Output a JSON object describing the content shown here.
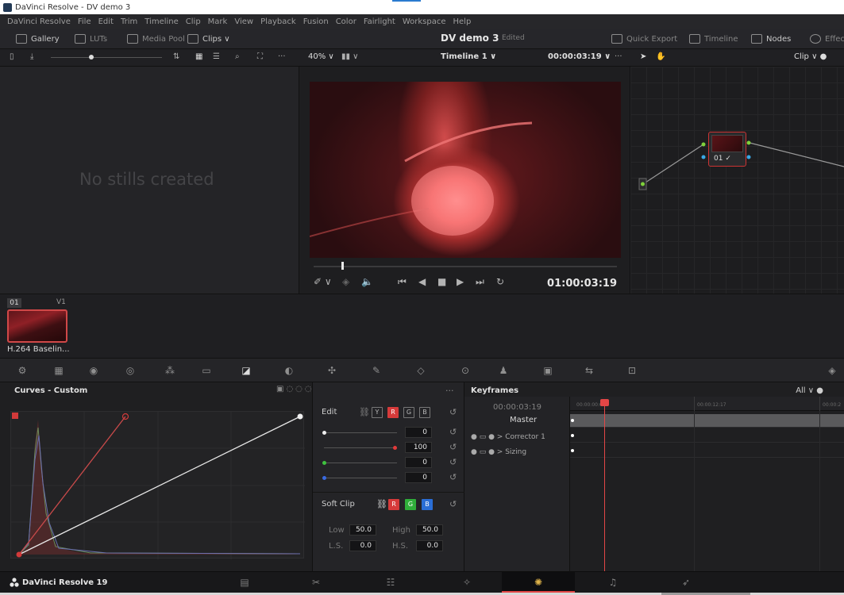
{
  "window": {
    "title": "DaVinci Resolve - DV demo 3"
  },
  "menu": [
    "DaVinci Resolve",
    "File",
    "Edit",
    "Trim",
    "Timeline",
    "Clip",
    "Mark",
    "View",
    "Playback",
    "Fusion",
    "Color",
    "Fairlight",
    "Workspace",
    "Help"
  ],
  "toolbar": {
    "gallery": "Gallery",
    "luts": "LUTs",
    "media_pool": "Media Pool",
    "clips": "Clips ∨",
    "project_name": "DV demo 3",
    "project_state": "Edited",
    "quick_export": "Quick Export",
    "timeline": "Timeline",
    "nodes": "Nodes",
    "effects": "Effec"
  },
  "viewer_row": {
    "zoom": "40%  ∨",
    "timeline_name": "Timeline 1  ∨",
    "timecode": "00:00:03:19  ∨",
    "more": "···",
    "clip_mode": "Clip ∨ ●"
  },
  "gallery": {
    "empty_text": "No stills created"
  },
  "viewer": {
    "timecode": "01:00:03:19"
  },
  "node": {
    "label": "01 ✓"
  },
  "clip": {
    "number": "01",
    "track": "V1",
    "name": "H.264 Baselin..."
  },
  "curves": {
    "title": "Curves - Custom"
  },
  "edit": {
    "label": "Edit",
    "channels": [
      "Y",
      "R",
      "G",
      "B"
    ],
    "values": [
      "0",
      "100",
      "0",
      "0"
    ],
    "soft_clip": "Soft Clip",
    "soft_channels": [
      "R",
      "G",
      "B"
    ],
    "low_label": "Low",
    "low": "50.0",
    "high_label": "High",
    "high": "50.0",
    "ls_label": "L.S.",
    "ls": "0.0",
    "hs_label": "H.S.",
    "hs": "0.0"
  },
  "keyframes": {
    "title": "Keyframes",
    "filter": "All ∨  ●",
    "timecode": "00:00:03:19",
    "master": "Master",
    "rows": [
      "Corrector 1",
      "Sizing"
    ],
    "ticks": [
      "00:00:00:00",
      "00:00:12:17",
      "00:00:2"
    ]
  },
  "pagebar": {
    "brand": "DaVinci Resolve 19"
  },
  "colors": {
    "accent_red": "#e34646",
    "panel_bg": "#1f1f21",
    "node_green": "#7fd13b",
    "node_blue": "#3aa8e6"
  }
}
